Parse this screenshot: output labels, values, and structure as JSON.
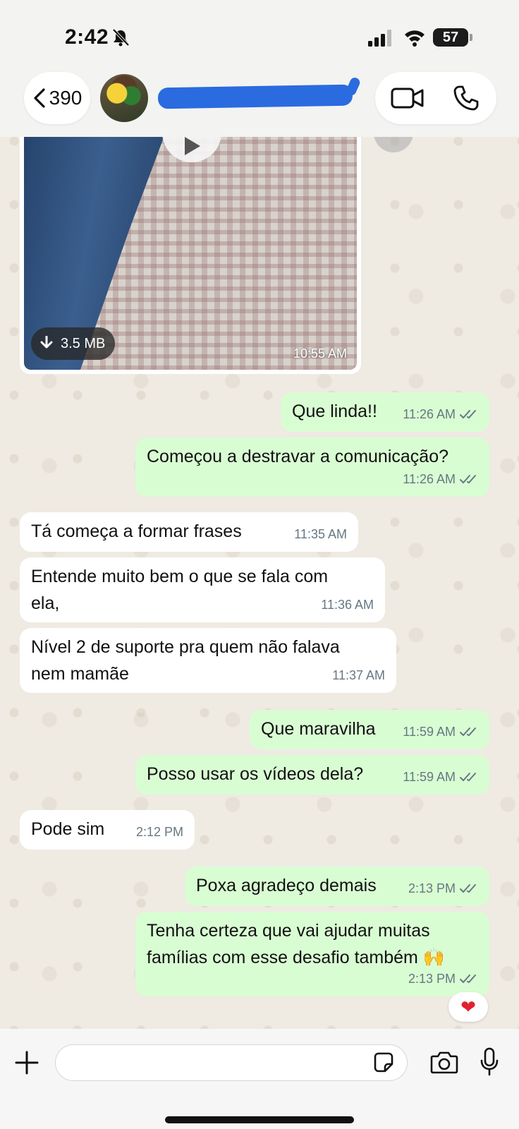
{
  "status_bar": {
    "time": "2:42",
    "battery": "57"
  },
  "header": {
    "back_count": "390",
    "contact_name_redacted": true
  },
  "media": {
    "download_size": "3.5 MB",
    "time": "10:55 AM"
  },
  "messages": [
    {
      "direction": "out",
      "text": "Que linda!!",
      "time": "11:26 AM",
      "read": true
    },
    {
      "direction": "out",
      "text": "Começou a destravar a comunicação?",
      "time": "11:26 AM",
      "read": true
    },
    {
      "direction": "in",
      "text": "Tá começa a formar frases",
      "time": "11:35 AM"
    },
    {
      "direction": "in",
      "text": "Entende muito bem o que se fala com\nela,",
      "time": "11:36 AM"
    },
    {
      "direction": "in",
      "text": "Nível 2 de suporte pra quem não falava\nnem mamãe",
      "time": "11:37 AM"
    },
    {
      "direction": "out",
      "text": "Que maravilha",
      "time": "11:59 AM",
      "read": true
    },
    {
      "direction": "out",
      "text": "Posso usar os vídeos dela?",
      "time": "11:59 AM",
      "read": true
    },
    {
      "direction": "in",
      "text": "Pode sim",
      "time": "2:12 PM"
    },
    {
      "direction": "out",
      "text": "Poxa agradeço demais",
      "time": "2:13 PM",
      "read": true
    },
    {
      "direction": "out",
      "text": "Tenha certeza que vai ajudar muitas\nfamílias com esse desafio também 🙌",
      "time": "2:13 PM",
      "read": true
    }
  ],
  "reaction": "❤",
  "input": {
    "value": "",
    "placeholder": ""
  },
  "colors": {
    "outgoing_bubble": "#d9fdd3",
    "incoming_bubble": "#ffffff",
    "read_check": "#667781",
    "redaction": "#2a6be0"
  },
  "icons": [
    "bell-off-icon",
    "signal-icon",
    "wifi-icon",
    "chevron-left-icon",
    "video-icon",
    "phone-icon",
    "play-icon",
    "download-icon",
    "forward-icon",
    "double-check-icon",
    "plus-icon",
    "sticker-icon",
    "camera-icon",
    "mic-icon"
  ]
}
